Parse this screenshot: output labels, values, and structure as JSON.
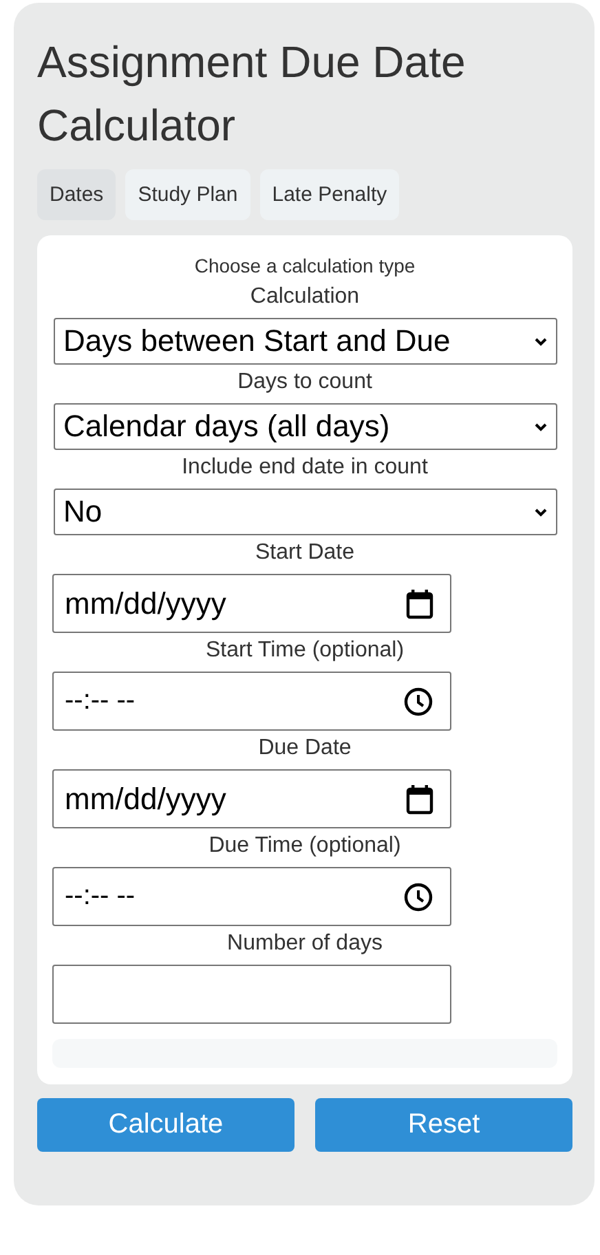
{
  "title": "Assignment Due Date Calculator",
  "tabs": [
    {
      "label": "Dates",
      "selected": true
    },
    {
      "label": "Study Plan",
      "selected": false
    },
    {
      "label": "Late Penalty",
      "selected": false
    }
  ],
  "hint": "Choose a calculation type",
  "fields": [
    {
      "kind": "select",
      "label": "Calculation",
      "value": "Days between Start and Due"
    },
    {
      "kind": "select",
      "label": "Days to count",
      "value": "Calendar days (all days)"
    },
    {
      "kind": "select",
      "label": "Include end date in count",
      "value": "No"
    },
    {
      "kind": "date",
      "label": "Start Date",
      "placeholder": "mm/dd/yyyy"
    },
    {
      "kind": "time",
      "label": "Start Time (optional)",
      "placeholder": "--:-- --"
    },
    {
      "kind": "date",
      "label": "Due Date",
      "placeholder": "mm/dd/yyyy"
    },
    {
      "kind": "time",
      "label": "Due Time (optional)",
      "placeholder": "--:-- --"
    },
    {
      "kind": "number",
      "label": "Number of days"
    }
  ],
  "buttons": [
    "Calculate",
    "Reset"
  ]
}
